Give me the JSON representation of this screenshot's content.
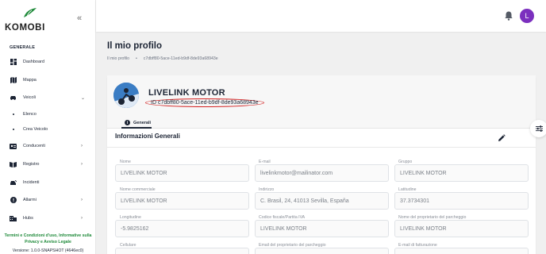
{
  "brand": {
    "name": "KOMOBI",
    "accent": "#1f8a3a"
  },
  "sidebar": {
    "section": "GENERALE",
    "items": [
      {
        "label": "Dashboard",
        "icon": "dashboard-icon"
      },
      {
        "label": "Mappa",
        "icon": "map-icon"
      },
      {
        "label": "Veicoli",
        "icon": "car-icon",
        "expanded": true
      },
      {
        "label": "Elenco"
      },
      {
        "label": "Crea Veicolo"
      },
      {
        "label": "Conducenti",
        "icon": "id-card-icon"
      },
      {
        "label": "Registro",
        "icon": "book-icon"
      },
      {
        "label": "Incidenti",
        "icon": "car-crash-icon"
      },
      {
        "label": "Allarmi",
        "icon": "alert-icon"
      },
      {
        "label": "Hubs",
        "icon": "building-icon"
      }
    ],
    "footer_line1": "Termini e Condizioni d'uso, Informative sulla",
    "footer_line2": "Privacy e Avviso Legale",
    "version": "Versione: 1.0.0-SNAPSHOT (4646ec0)"
  },
  "topbar": {
    "avatar_initial": "L",
    "avatar_color": "#7b2fbe"
  },
  "page": {
    "title": "Il mio profilo",
    "breadcrumb": [
      "Il mio profilo",
      "c7dbff80-5ace-11ed-b9df-8de93a68943e"
    ]
  },
  "profile": {
    "name": "LIVELINK MOTOR",
    "id": "ID c7dbff80-5ace-11ed-b9df-8de93a68943e",
    "tab": "Generali"
  },
  "info": {
    "section_title": "Informazioni Generali",
    "fields": [
      {
        "label": "Nome",
        "value": "LIVELINK MOTOR"
      },
      {
        "label": "E-mail",
        "value": "livelinkmotor@mailinator.com"
      },
      {
        "label": "Gruppo",
        "value": "LIVELINK MOTOR"
      },
      {
        "label": "Nome commerciale",
        "value": "LIVELINK MOTOR"
      },
      {
        "label": "Indirizzo",
        "value": "C. Brasil, 24, 41013 Sevilla, España"
      },
      {
        "label": "Latitudine",
        "value": "37.3734301"
      },
      {
        "label": "Longitudine",
        "value": "-5.9825162"
      },
      {
        "label": "Codice fiscale/Partita IVA",
        "value": "LIVELINK MOTOR"
      },
      {
        "label": "Nome del proprietario del parcheggio",
        "value": "LIVELINK MOTOR"
      },
      {
        "label": "Cellulare",
        "value": ""
      },
      {
        "label": "Email del proprietario del parcheggio",
        "value": ""
      },
      {
        "label": "E-mail di fatturazione",
        "value": ""
      }
    ]
  }
}
